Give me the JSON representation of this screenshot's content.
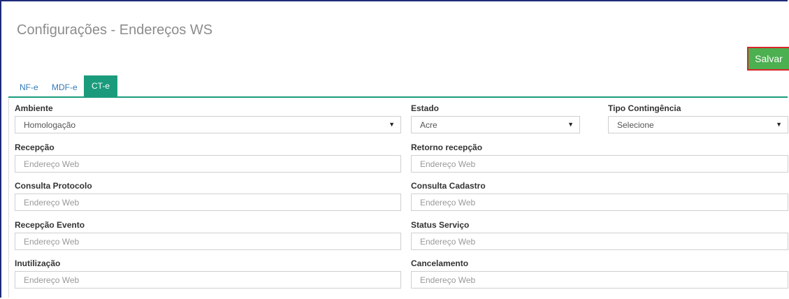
{
  "page": {
    "title": "Configurações - Endereços WS"
  },
  "toolbar": {
    "save_label": "Salvar"
  },
  "tabs": [
    {
      "label": "NF-e",
      "active": false
    },
    {
      "label": "MDF-e",
      "active": false
    },
    {
      "label": "CT-e",
      "active": true
    }
  ],
  "form": {
    "ambiente": {
      "label": "Ambiente",
      "value": "Homologação"
    },
    "estado": {
      "label": "Estado",
      "value": "Acre"
    },
    "tipo_contingencia": {
      "label": "Tipo Contingência",
      "value": "Selecione"
    },
    "recepcao": {
      "label": "Recepção",
      "placeholder": "Endereço Web"
    },
    "retorno_recepcao": {
      "label": "Retorno recepção",
      "placeholder": "Endereço Web"
    },
    "consulta_protocolo": {
      "label": "Consulta Protocolo",
      "placeholder": "Endereço Web"
    },
    "consulta_cadastro": {
      "label": "Consulta Cadastro",
      "placeholder": "Endereço Web"
    },
    "recepcao_evento": {
      "label": "Recepção Evento",
      "placeholder": "Endereço Web"
    },
    "status_servico": {
      "label": "Status Serviço",
      "placeholder": "Endereço Web"
    },
    "inutilizacao": {
      "label": "Inutilização",
      "placeholder": "Endereço Web"
    },
    "cancelamento": {
      "label": "Cancelamento",
      "placeholder": "Endereço Web"
    }
  },
  "icons": {
    "dropdown": "caret-down-icon",
    "glyph": "▼"
  },
  "colors": {
    "accent": "#1a9c7c",
    "save": "#4caf50",
    "highlight": "#d9252b",
    "link": "#337ab7"
  }
}
